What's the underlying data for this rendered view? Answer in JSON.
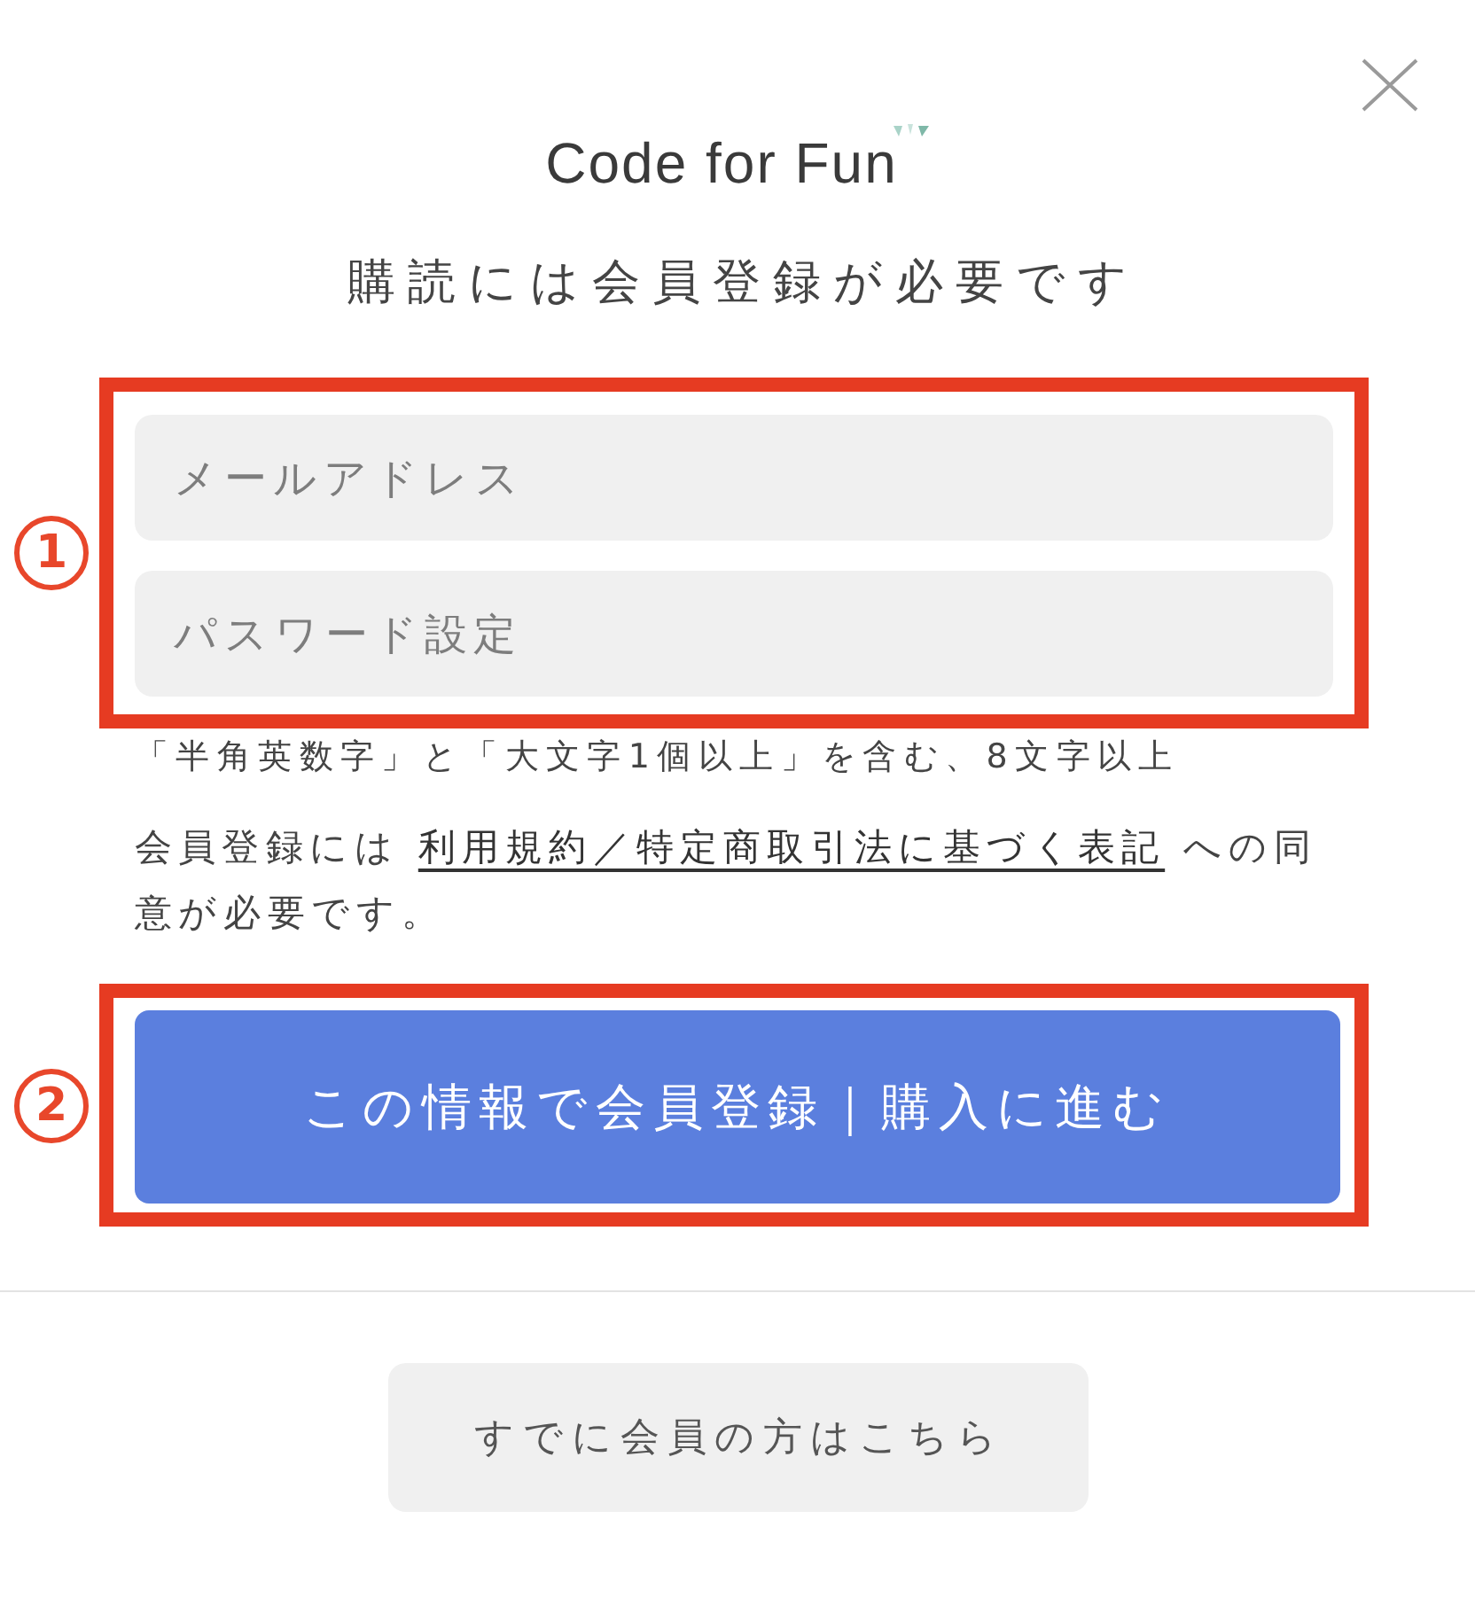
{
  "logo": {
    "text": "Code for Fun"
  },
  "heading": "購読には会員登録が必要です",
  "form": [
    {
      "kind": "fields",
      "marker": "1",
      "fields": [
        {
          "placeholder": "メールアドレス"
        },
        {
          "placeholder": "パスワード設定"
        }
      ]
    },
    {
      "kind": "note",
      "text": "「半角英数字」と「大文字1個以上」を含む、8文字以上"
    },
    {
      "kind": "terms",
      "before": "会員登録には ",
      "link": "利用規約／特定商取引法に基づく表記",
      "after": " への同意が必要です。"
    },
    {
      "kind": "submit",
      "marker": "2",
      "label": "この情報で会員登録｜購入に進む"
    }
  ],
  "login_button": {
    "label": "すでに会員の方はこちら"
  }
}
